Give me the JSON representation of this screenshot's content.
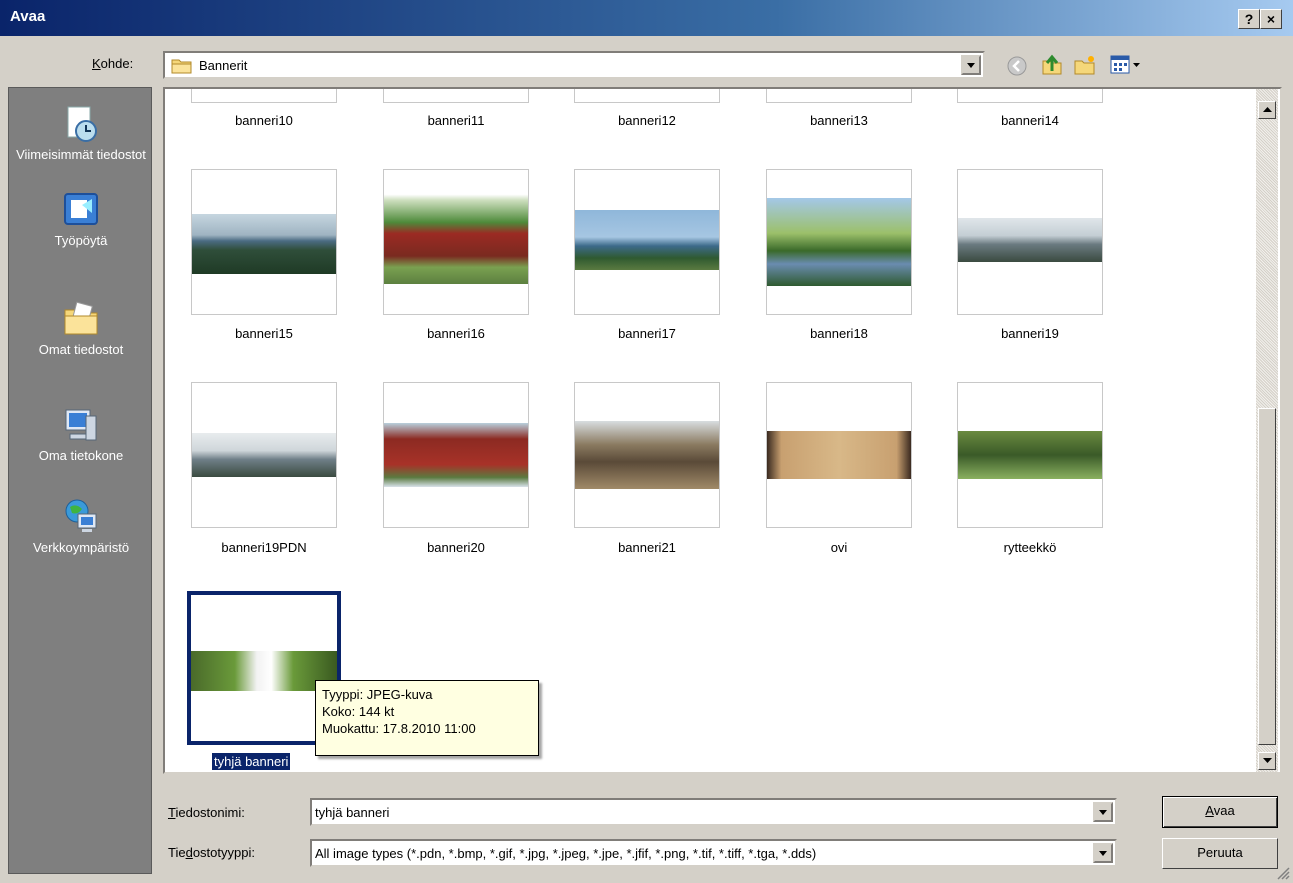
{
  "window": {
    "title": "Avaa",
    "help_btn": "?",
    "close_btn": "×"
  },
  "lookin": {
    "label_pre": "",
    "label_key": "K",
    "label_post": "ohde:",
    "value": "Bannerit"
  },
  "toolbar_icons": [
    "back-icon",
    "up-folder-icon",
    "new-folder-icon",
    "view-menu-icon"
  ],
  "places": [
    {
      "label": "Viimeisimmät tiedostot",
      "icon": "recent-documents-icon"
    },
    {
      "label": "Työpöytä",
      "icon": "desktop-icon"
    },
    {
      "label": "Omat tiedostot",
      "icon": "my-documents-icon"
    },
    {
      "label": "Oma tietokone",
      "icon": "my-computer-icon"
    },
    {
      "label": "Verkkoympäristö",
      "icon": "network-places-icon"
    }
  ],
  "files": {
    "row0": [
      "banneri10",
      "banneri11",
      "banneri12",
      "banneri13",
      "banneri14"
    ],
    "row1": [
      "banneri15",
      "banneri16",
      "banneri17",
      "banneri18",
      "banneri19"
    ],
    "row2": [
      "banneri19PDN",
      "banneri20",
      "banneri21",
      "ovi",
      "rytteekkö"
    ],
    "row3": [
      "tyhjä banneri"
    ]
  },
  "tooltip": {
    "type": "Tyyppi: JPEG-kuva",
    "size": "Koko: 144 kt",
    "modified": "Muokattu: 17.8.2010 11:00"
  },
  "filename": {
    "label_key": "T",
    "label_post": "iedostonimi:",
    "value": "tyhjä banneri"
  },
  "filetype": {
    "label_pre": "Tie",
    "label_key": "d",
    "label_post": "ostotyyppi:",
    "value": "All image types (*.pdn, *.bmp, *.gif, *.jpg, *.jpeg, *.jpe, *.jfif, *.png, *.tif, *.tiff, *.tga, *.dds)"
  },
  "buttons": {
    "open_key": "A",
    "open_rest": "vaa",
    "cancel": "Peruuta"
  }
}
